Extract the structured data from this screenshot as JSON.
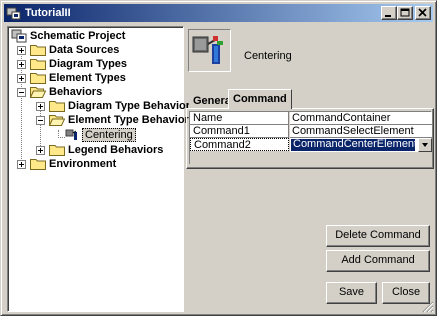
{
  "window": {
    "title": "TutorialII"
  },
  "tree": {
    "root": "Schematic Project",
    "items": [
      {
        "label": "Data Sources"
      },
      {
        "label": "Diagram Types"
      },
      {
        "label": "Element Types"
      },
      {
        "label": "Behaviors"
      },
      {
        "label": "Diagram Type Behaviors"
      },
      {
        "label": "Element Type Behaviors"
      },
      {
        "label": "Centering"
      },
      {
        "label": "Legend Behaviors"
      },
      {
        "label": "Environment"
      }
    ]
  },
  "detail": {
    "heading": "Centering",
    "tabs": [
      {
        "label": "General"
      },
      {
        "label": "Command"
      }
    ],
    "active_tab": "Command",
    "properties": [
      {
        "name": "Name",
        "value": "CommandContainer"
      },
      {
        "name": "Command1",
        "value": "CommandSelectElement"
      },
      {
        "name": "Command2",
        "value": "CommandCenterElement"
      }
    ]
  },
  "buttons": {
    "delete_command": "Delete Command",
    "add_command": "Add Command",
    "save": "Save",
    "close": "Close"
  },
  "colors": {
    "titlebar_start": "#0a246a",
    "titlebar_end": "#a6caf0",
    "face": "#d4d0c8",
    "selection": "#0a246a"
  }
}
